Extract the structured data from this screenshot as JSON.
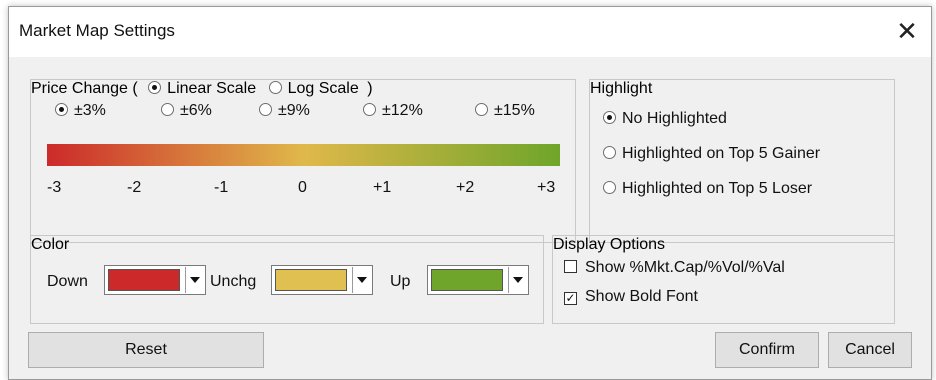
{
  "window": {
    "title": "Market Map Settings",
    "close_glyph": "✕"
  },
  "price_change": {
    "legend_prefix": "Price Change (",
    "legend_suffix": ")",
    "scale_options": [
      {
        "label": "Linear Scale",
        "selected": true
      },
      {
        "label": "Log Scale",
        "selected": false
      }
    ],
    "range_options": [
      {
        "label": "±3%",
        "selected": true
      },
      {
        "label": "±6%",
        "selected": false
      },
      {
        "label": "±9%",
        "selected": false
      },
      {
        "label": "±12%",
        "selected": false
      },
      {
        "label": "±15%",
        "selected": false
      }
    ],
    "ticks": [
      "-3",
      "-2",
      "-1",
      "0",
      "+1",
      "+2",
      "+3"
    ],
    "gradient_colors": [
      "#cc2a2a",
      "#e0b84a",
      "#6fa52a"
    ]
  },
  "highlight": {
    "legend": "Highlight",
    "options": [
      {
        "label": "No Highlighted",
        "selected": true
      },
      {
        "label": "Highlighted on Top 5 Gainer",
        "selected": false
      },
      {
        "label": "Highlighted on Top 5 Loser",
        "selected": false
      }
    ]
  },
  "color": {
    "legend": "Color",
    "down_label": "Down",
    "unchg_label": "Unchg",
    "up_label": "Up",
    "down_color": "#cc2a2a",
    "unchg_color": "#e0c050",
    "up_color": "#6fa52a"
  },
  "display_options": {
    "legend": "Display Options",
    "options": [
      {
        "label": "Show %Mkt.Cap/%Vol/%Val",
        "checked": false
      },
      {
        "label": "Show Bold Font",
        "checked": true
      }
    ]
  },
  "buttons": {
    "reset": "Reset",
    "confirm": "Confirm",
    "cancel": "Cancel"
  }
}
